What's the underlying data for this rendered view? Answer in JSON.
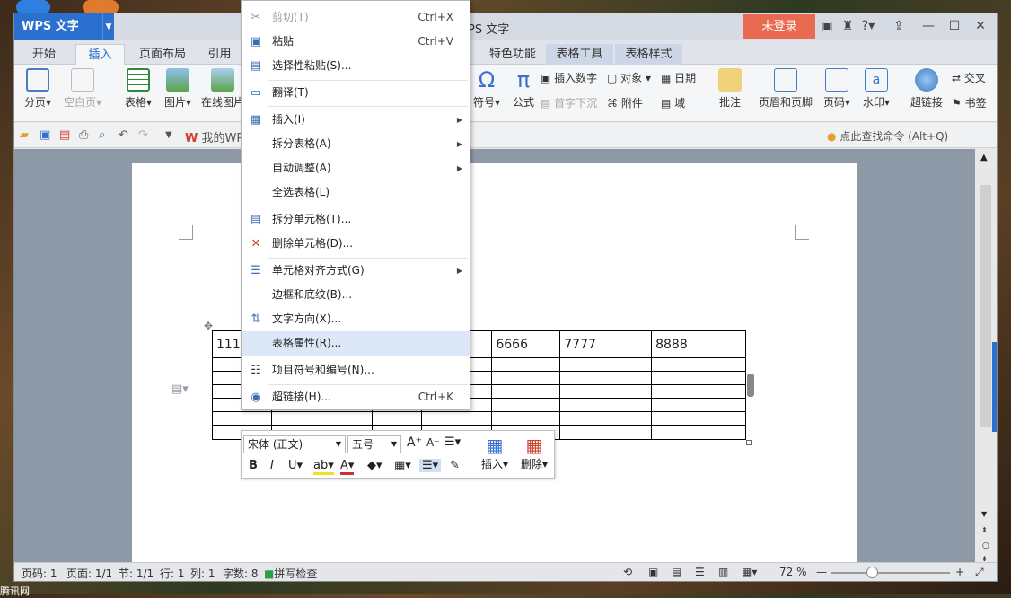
{
  "app": {
    "logo": "WPS 文字",
    "title": "PS 文字",
    "login": "未登录"
  },
  "tabs": [
    "开始",
    "插入",
    "页面布局",
    "引用",
    "特色功能",
    "表格工具",
    "表格样式"
  ],
  "ribbon": {
    "left": [
      "分页",
      "空白页",
      "表格",
      "图片",
      "在线图片"
    ],
    "symbols": {
      "symbol": "符号",
      "formula": "公式",
      "insert_number": "插入数字",
      "drop_cap": "首字下沉",
      "object": "对象",
      "attachment": "附件",
      "date": "日期",
      "field": "域"
    },
    "right": [
      "批注",
      "页眉和页脚",
      "页码",
      "水印",
      "超链接",
      "书签",
      "交叉"
    ]
  },
  "quickbar": {
    "my_wps": "我的WPS",
    "search_cmd": "点此查找命令 (Alt+Q)"
  },
  "context_menu": [
    {
      "label": "剪切(T)",
      "shortcut": "Ctrl+X",
      "icon": "scissors-icon",
      "disabled": true
    },
    {
      "label": "粘贴",
      "shortcut": "Ctrl+V",
      "icon": "paste-icon"
    },
    {
      "label": "选择性粘贴(S)...",
      "icon": "paste-special-icon"
    },
    {
      "label": "翻译(T)",
      "icon": "translate-icon"
    },
    {
      "label": "插入(I)",
      "icon": "table-insert-icon",
      "submenu": true
    },
    {
      "label": "拆分表格(A)",
      "submenu": true
    },
    {
      "label": "自动调整(A)",
      "submenu": true
    },
    {
      "label": "全选表格(L)"
    },
    {
      "label": "拆分单元格(T)...",
      "icon": "split-cell-icon"
    },
    {
      "label": "删除单元格(D)...",
      "icon": "delete-cell-icon"
    },
    {
      "label": "单元格对齐方式(G)",
      "icon": "cell-align-icon",
      "submenu": true
    },
    {
      "label": "边框和底纹(B)..."
    },
    {
      "label": "文字方向(X)...",
      "icon": "text-direction-icon"
    },
    {
      "label": "表格属性(R)...",
      "highlighted": true
    },
    {
      "label": "项目符号和编号(N)...",
      "icon": "bullets-icon"
    },
    {
      "label": "超链接(H)...",
      "shortcut": "Ctrl+K",
      "icon": "hyperlink-icon"
    }
  ],
  "table": {
    "first_row": [
      "111",
      "",
      "",
      "",
      "",
      "6666",
      "7777",
      "8888"
    ]
  },
  "mini_toolbar": {
    "font": "宋体 (正文)",
    "size": "五号",
    "insert": "插入",
    "delete": "删除"
  },
  "status": {
    "page_code": "页码: 1",
    "page": "页面: 1/1",
    "section": "节: 1/1",
    "row": "行: 1",
    "col": "列: 1",
    "words": "字数: 8",
    "spell": "拼写检查",
    "zoom": "72 %"
  },
  "desktop": {
    "bottom_label": "腾讯网"
  },
  "colors": {
    "accent": "#2b6fcf",
    "login": "#e86a50",
    "highlight": "#dce8f7"
  }
}
